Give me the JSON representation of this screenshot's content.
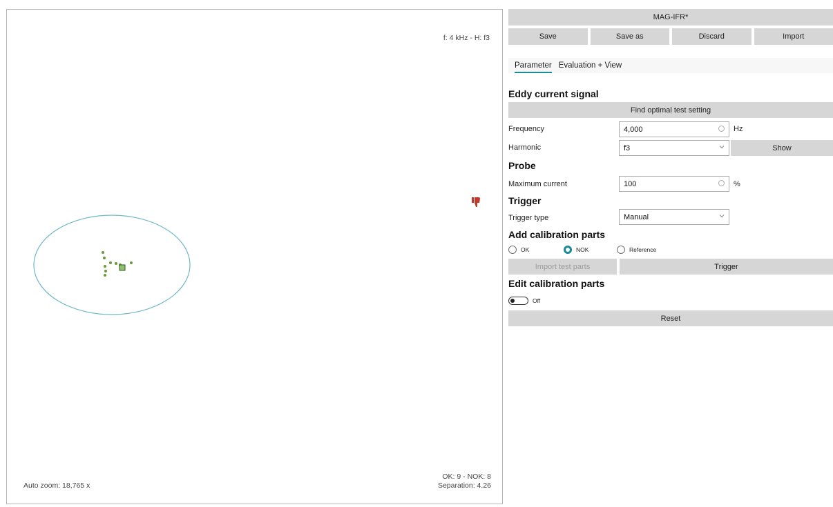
{
  "plot": {
    "frequency_harmonic": "f: 4 kHz - H: f3",
    "auto_zoom": "Auto zoom: 18,765 x",
    "ok_nok": "OK: 9 - NOK: 8",
    "separation": "Separation: 4.26",
    "ellipse_color": "#6fb7c9",
    "point_color": "#6a9a3a",
    "icon": "thumbs-down-icon",
    "icon_color": "#c0392b"
  },
  "panel": {
    "title": "MAG-IFR*",
    "buttons": {
      "save": "Save",
      "save_as": "Save as",
      "discard": "Discard",
      "import": "Import"
    },
    "tabs": {
      "parameter": "Parameter",
      "evaluation": "Evaluation + View"
    },
    "eddy": {
      "heading": "Eddy current signal",
      "find_optimal": "Find optimal test setting",
      "frequency_label": "Frequency",
      "frequency_value": "4,000",
      "frequency_unit": "Hz",
      "harmonic_label": "Harmonic",
      "harmonic_value": "f3",
      "show": "Show"
    },
    "probe": {
      "heading": "Probe",
      "max_current_label": "Maximum current",
      "max_current_value": "100",
      "max_current_unit": "%"
    },
    "trigger": {
      "heading": "Trigger",
      "type_label": "Trigger type",
      "type_value": "Manual"
    },
    "add_parts": {
      "heading": "Add calibration parts",
      "radio_ok": "OK",
      "radio_nok": "NOK",
      "radio_reference": "Reference",
      "selected": "NOK",
      "import_test_parts": "Import test parts",
      "trigger": "Trigger"
    },
    "edit_parts": {
      "heading": "Edit calibration parts",
      "toggle_state": "Off",
      "reset": "Reset"
    },
    "accent_color": "#1c8a94"
  }
}
